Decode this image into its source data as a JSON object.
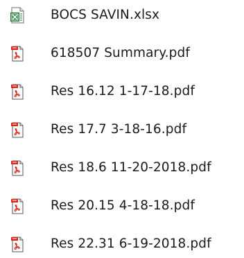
{
  "files": [
    {
      "name": "BOCS SAVIN.xlsx",
      "icon": "excel-file-icon"
    },
    {
      "name": "618507 Summary.pdf",
      "icon": "pdf-file-icon"
    },
    {
      "name": "Res 16.12 1-17-18.pdf",
      "icon": "pdf-file-icon"
    },
    {
      "name": "Res 17.7 3-18-16.pdf",
      "icon": "pdf-file-icon"
    },
    {
      "name": "Res 18.6 11-20-2018.pdf",
      "icon": "pdf-file-icon"
    },
    {
      "name": "Res 20.15 4-18-18.pdf",
      "icon": "pdf-file-icon"
    },
    {
      "name": "Res 22.31 6-19-2018.pdf",
      "icon": "pdf-file-icon"
    }
  ],
  "colors": {
    "excel_green": "#1f7a3a",
    "pdf_red": "#d8261c",
    "text": "#1a1a1a"
  }
}
